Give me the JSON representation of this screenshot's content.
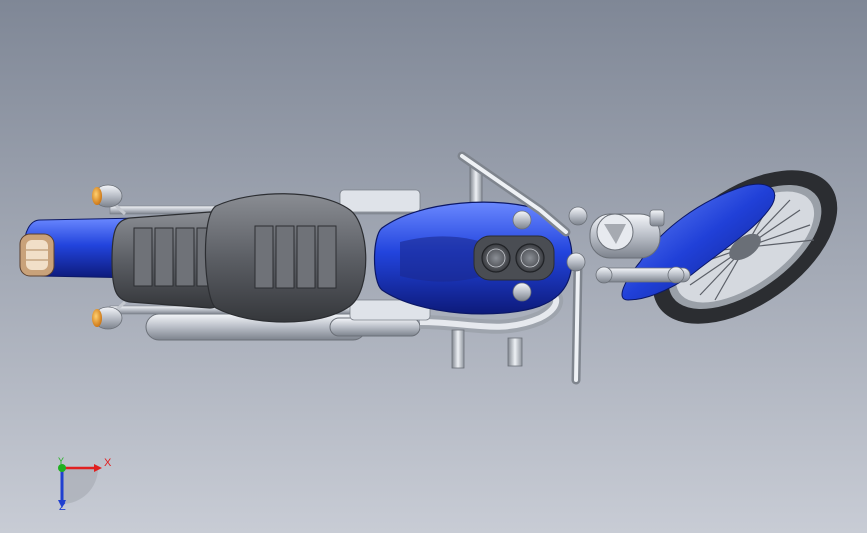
{
  "viewport": {
    "background_top": "#7f8796",
    "background_bottom": "#c6cad3"
  },
  "colors": {
    "body_blue": "#1f3fd6",
    "body_blue_light": "#5f80ff",
    "body_blue_dark": "#102086",
    "seat_gray": "#5a5d63",
    "seat_gray_dark": "#3a3c41",
    "chrome": "#cfd3da",
    "tire": "#2b2d31",
    "amber": "#f0a020"
  },
  "model": {
    "name_icon": "motorcycle-model-top-view"
  },
  "triad": {
    "x_label": "X",
    "y_label": "Y",
    "z_label": "Z",
    "x_color": "#e02020",
    "y_color": "#20b020",
    "z_color": "#2040d0"
  }
}
